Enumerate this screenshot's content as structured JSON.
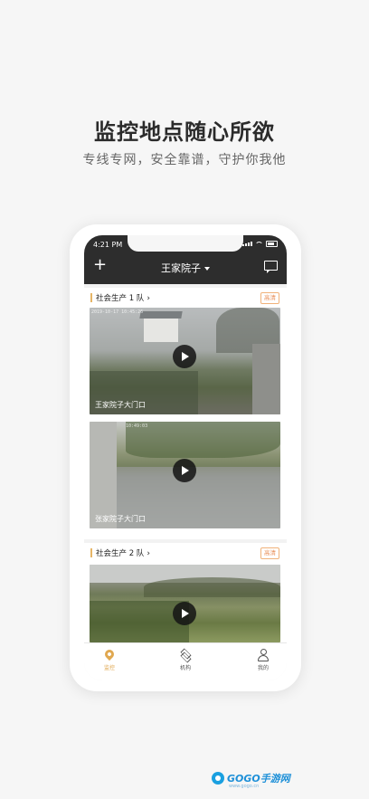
{
  "headline": "监控地点随心所欲",
  "subline": "专线专网，安全靠谱，守护你我他",
  "status_bar": {
    "time": "4:21 PM"
  },
  "nav": {
    "title": "王家院子"
  },
  "groups": [
    {
      "title": "社会生产 1 队",
      "badge": "高清",
      "cameras": [
        {
          "caption": "王家院子大门口",
          "stamp": "2019-10-17   10:45:26"
        },
        {
          "caption": "张家院子大门口",
          "stamp": "10:49:03"
        }
      ]
    },
    {
      "title": "社会生产 2 队",
      "badge": "高清",
      "cameras": [
        {
          "caption": "",
          "stamp": ""
        }
      ]
    }
  ],
  "tabbar": {
    "items": [
      {
        "label": "监控",
        "icon": "location-pin-icon",
        "active": true
      },
      {
        "label": "机构",
        "icon": "layers-icon",
        "active": false
      },
      {
        "label": "我的",
        "icon": "person-icon",
        "active": false
      }
    ]
  },
  "watermark": {
    "brand": "GOGO手游网",
    "url": "www.gogo.cn"
  },
  "colors": {
    "accent": "#e0a850",
    "topbar": "#2d2d2d",
    "badge": "#e9905a"
  }
}
